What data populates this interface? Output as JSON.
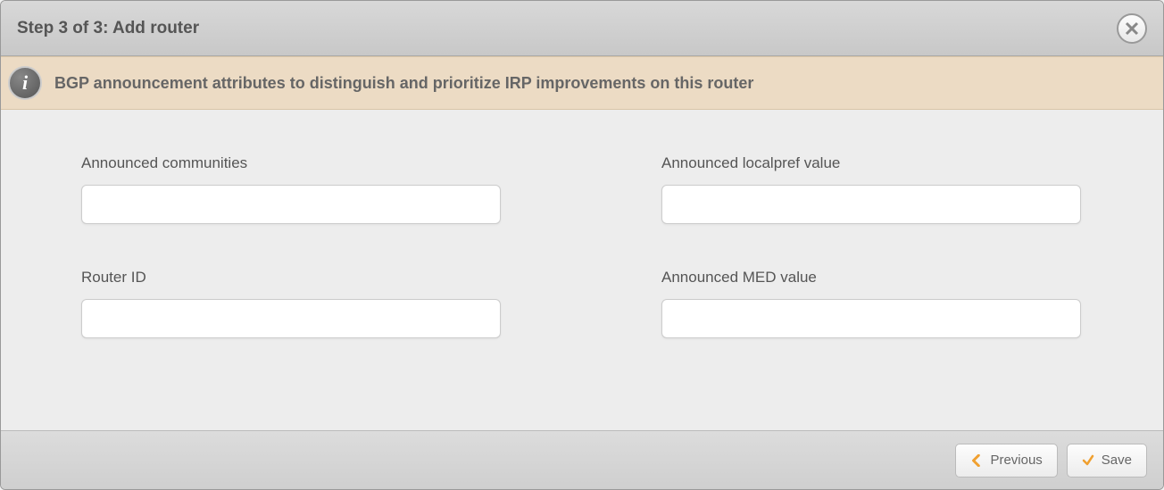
{
  "header": {
    "title": "Step 3 of 3: Add router"
  },
  "info": {
    "text": "BGP announcement attributes to distinguish and prioritize IRP improvements on this router"
  },
  "form": {
    "left": [
      {
        "label": "Announced communities",
        "value": ""
      },
      {
        "label": "Router ID",
        "value": ""
      }
    ],
    "right": [
      {
        "label": "Announced localpref value",
        "value": ""
      },
      {
        "label": "Announced MED value",
        "value": ""
      }
    ]
  },
  "footer": {
    "previous": "Previous",
    "save": "Save"
  }
}
